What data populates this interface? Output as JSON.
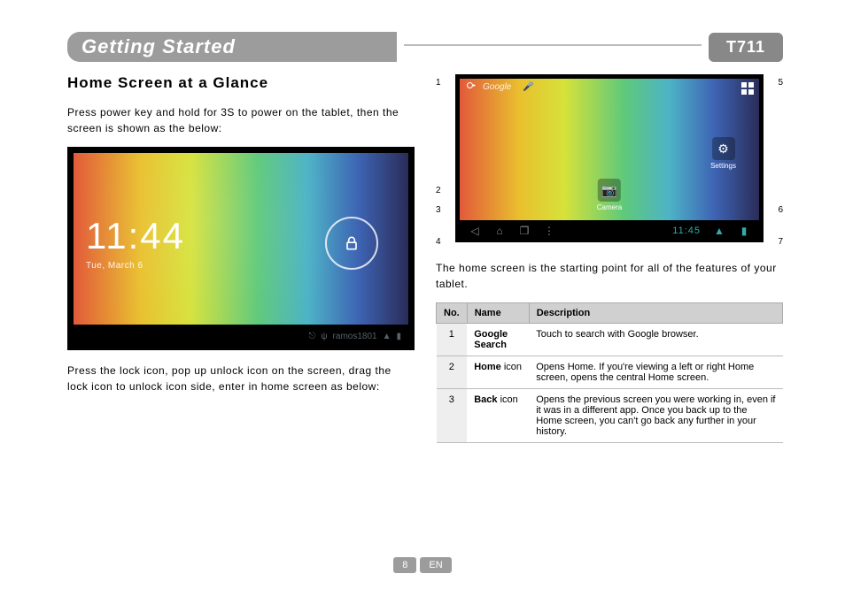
{
  "header": {
    "title": "Getting Started",
    "model": "T711"
  },
  "section_title": "Home Screen at a Glance",
  "para1": "Press power key and hold for 3S to power on the tablet, then the screen is shown as the below:",
  "lockscreen": {
    "time": "11:44",
    "date": "Tue, March 6",
    "status_user": "ramos1801"
  },
  "para2": "Press the lock icon, pop up unlock icon on the screen, drag the lock icon to unlock icon side, enter in home screen as below:",
  "para3": "The home screen is the starting point for all of the features of your tablet.",
  "homescreen": {
    "search_label": "Google",
    "settings_label": "Settings",
    "camera_label": "Camera",
    "nav_time": "11:45",
    "callouts_left": [
      "1",
      "2",
      "3",
      "4"
    ],
    "callouts_right": [
      "5",
      "6",
      "7"
    ]
  },
  "table": {
    "headers": {
      "no": "No.",
      "name": "Name",
      "desc": "Description"
    },
    "rows": [
      {
        "no": "1",
        "name_bold": "Google Search",
        "name_rest": "",
        "desc": "Touch to search with Google browser."
      },
      {
        "no": "2",
        "name_bold": "Home",
        "name_rest": " icon",
        "desc": "Opens Home. If you're viewing a left or right Home screen, opens the central Home screen."
      },
      {
        "no": "3",
        "name_bold": "Back",
        "name_rest": " icon",
        "desc": "Opens the previous screen you were working in, even if it was in a different app. Once you back up to the Home screen, you can't go back any further in your history."
      }
    ]
  },
  "footer": {
    "page": "8",
    "lang": "EN"
  }
}
